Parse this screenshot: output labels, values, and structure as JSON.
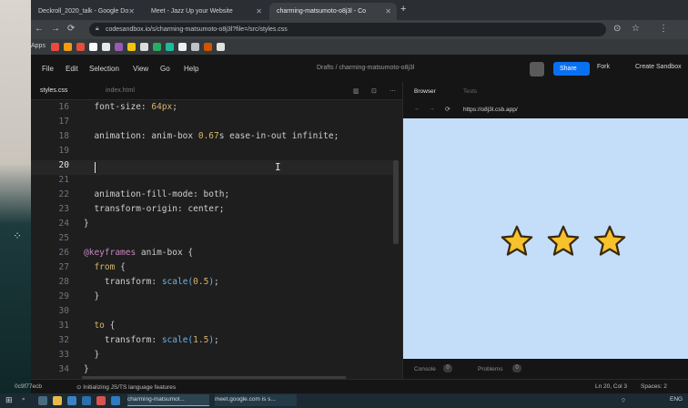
{
  "browser": {
    "tabs": [
      {
        "label": "Deckroll_2020_talk - Google Do"
      },
      {
        "label": "Meet - Jazz Up your Website"
      },
      {
        "label": "charming-matsumoto-o8j3l - Co"
      }
    ],
    "url": "codesandbox.io/s/charming-matsumoto-o8j3l?file=/src/styles.css",
    "apps_label": "Apps"
  },
  "menubar": {
    "items": [
      "File",
      "Edit",
      "Selection",
      "View",
      "Go",
      "Help"
    ],
    "drafts": "Drafts / charming-matsumoto-o8j3l",
    "share": "Share",
    "fork": "Fork",
    "create": "Create Sandbox"
  },
  "editor": {
    "active_tab": "styles.css",
    "second_tab": "index.html",
    "lines": [
      {
        "n": "16",
        "parts": [
          [
            "prop",
            "font-size: "
          ],
          [
            "num",
            "64px"
          ],
          [
            "prop",
            ";"
          ]
        ]
      },
      {
        "n": "17",
        "parts": []
      },
      {
        "n": "18",
        "parts": [
          [
            "prop",
            "animation: anim-box "
          ],
          [
            "num",
            "0.67"
          ],
          [
            "prop",
            "s ease-in-out infinite;"
          ]
        ]
      },
      {
        "n": "19",
        "parts": []
      },
      {
        "n": "20",
        "parts": []
      },
      {
        "n": "21",
        "parts": []
      },
      {
        "n": "22",
        "parts": [
          [
            "prop",
            "animation-fill-mode: both;"
          ]
        ]
      },
      {
        "n": "23",
        "parts": [
          [
            "prop",
            "transform-origin: center;"
          ]
        ]
      },
      {
        "n": "24",
        "parts": [
          [
            "prop",
            "}"
          ]
        ]
      },
      {
        "n": "25",
        "parts": []
      },
      {
        "n": "26",
        "parts": [
          [
            "kw",
            "@keyframes "
          ],
          [
            "prop",
            "anim-box {"
          ]
        ]
      },
      {
        "n": "27",
        "parts": [
          [
            "sel",
            "from "
          ],
          [
            "prop",
            "{"
          ]
        ]
      },
      {
        "n": "28",
        "parts": [
          [
            "prop",
            "transform: "
          ],
          [
            "fn",
            "scale("
          ],
          [
            "num",
            "0.5"
          ],
          [
            "fn",
            ")"
          ],
          [
            "prop",
            ";"
          ]
        ]
      },
      {
        "n": "29",
        "parts": [
          [
            "prop",
            "}"
          ]
        ]
      },
      {
        "n": "30",
        "parts": []
      },
      {
        "n": "31",
        "parts": [
          [
            "sel",
            "to "
          ],
          [
            "prop",
            "{"
          ]
        ]
      },
      {
        "n": "32",
        "parts": [
          [
            "prop",
            "transform: "
          ],
          [
            "fn",
            "scale("
          ],
          [
            "num",
            "1.5"
          ],
          [
            "fn",
            ")"
          ],
          [
            "prop",
            ";"
          ]
        ]
      },
      {
        "n": "33",
        "parts": [
          [
            "prop",
            "}"
          ]
        ]
      },
      {
        "n": "34",
        "parts": [
          [
            "prop",
            "}"
          ]
        ]
      }
    ]
  },
  "preview": {
    "tab_browser": "Browser",
    "tab_tests": "Tests",
    "address": "https://o8j3l.csb.app/",
    "console": "Console",
    "console_count": "0",
    "problems": "Problems",
    "problems_count": "0",
    "star_color": "#f7c22b"
  },
  "statusbar": {
    "left": "0c9f77ecb",
    "message": "Initializing JS/TS language features",
    "position": "Ln 20, Col 3",
    "spaces": "Spaces: 2"
  },
  "taskbar": {
    "items": [
      "charming-matsumot...",
      "meet.google.com is s..."
    ],
    "lang": "ENG"
  }
}
